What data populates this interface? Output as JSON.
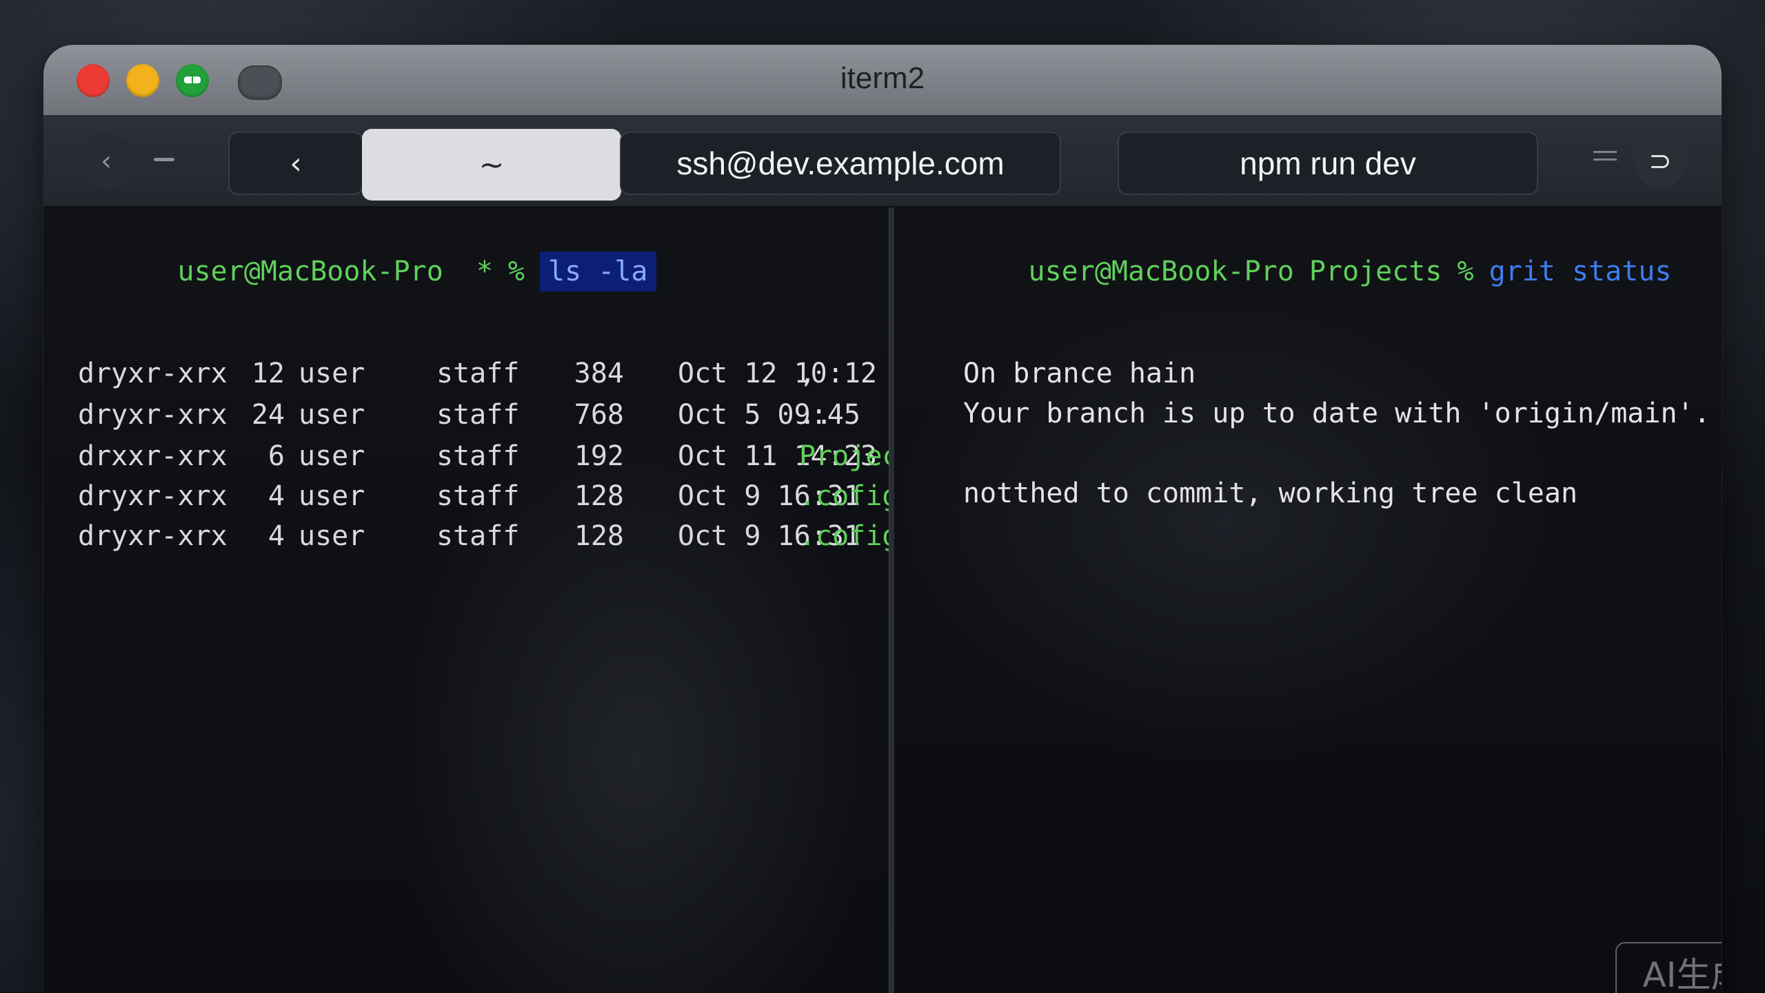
{
  "window": {
    "title": "iterm2"
  },
  "tabbar": {
    "back_glyph": "‹",
    "home_tab_label": "~",
    "menu_glyph": "⊃",
    "tabs": [
      {
        "label": "ssh@dev.example.com"
      },
      {
        "label": "npm run dev"
      }
    ],
    "nav_glyph": "‹"
  },
  "left_pane": {
    "prompt_user": "user@MacBook-Pro",
    "prompt_dir": "*",
    "prompt_symbol": "%",
    "command": "ls -la",
    "listing": [
      {
        "perms": "dryxr-xrx",
        "links": "12",
        "owner": "user",
        "group": "staff",
        "size": "384",
        "date": "Oct 12 10:12",
        "name": ",",
        "highlight": false
      },
      {
        "perms": "dryxr-xrx",
        "links": "24",
        "owner": "user",
        "group": "staff",
        "size": "768",
        "date": "Oct 5 09:45",
        "name": "..",
        "highlight": false
      },
      {
        "perms": "drxxr-xrx",
        "links": "6",
        "owner": "user",
        "group": "staff",
        "size": "192",
        "date": "Oct 11 14:23",
        "name": "Projects",
        "highlight": true
      },
      {
        "perms": "dryxr-xrx",
        "links": "4",
        "owner": "user",
        "group": "staff",
        "size": "128",
        "date": "Oct 9 16:31",
        "name": ".cofig",
        "highlight": true
      },
      {
        "perms": "dryxr-xrx",
        "links": "4",
        "owner": "user",
        "group": "staff",
        "size": "128",
        "date": "Oct 9 16:31",
        "name": ".cofig",
        "highlight": true
      }
    ]
  },
  "right_pane": {
    "prompt_user": "user@MacBook-Pro",
    "prompt_dir": "Projects",
    "prompt_symbol": "%",
    "command": "grit status",
    "output": [
      "On brance hain",
      "Your branch is up to date with 'origin/main'.",
      "notthed to commit, working tree clean"
    ]
  },
  "watermark": "AI生成",
  "colors": {
    "prompt_green": "#5fd15a",
    "command_blue": "#3f7cf0",
    "close_red": "#ec3b34",
    "minimize_yellow": "#f2b21b",
    "zoom_green": "#22a13a"
  }
}
